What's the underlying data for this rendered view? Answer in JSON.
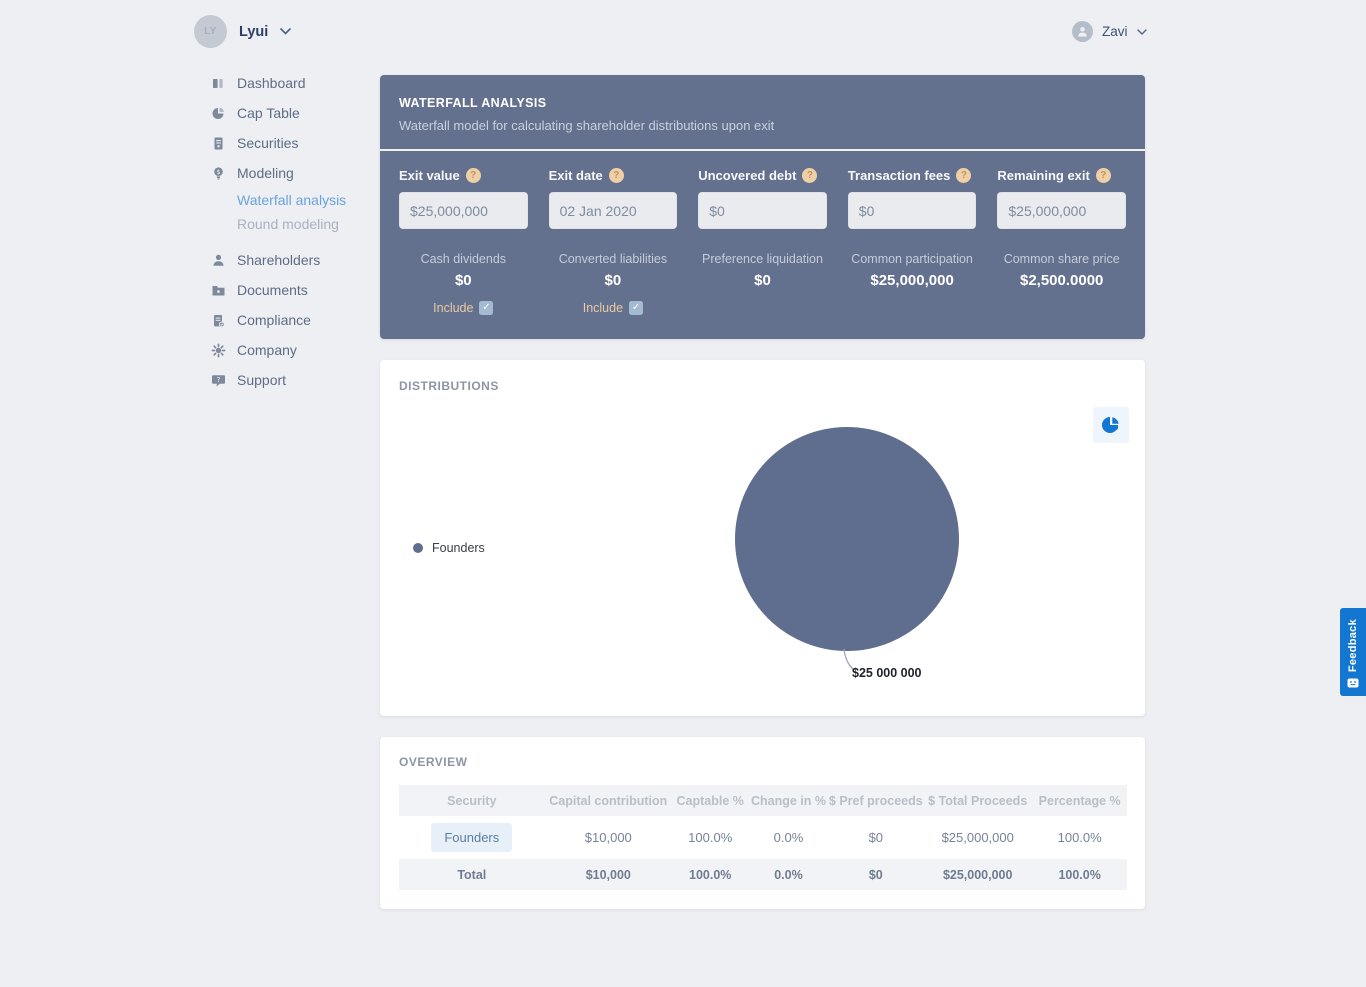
{
  "topbar": {
    "workspace": {
      "initials": "LY",
      "name": "Lyui"
    },
    "user": {
      "name": "Zavi"
    }
  },
  "sidebar": {
    "items": [
      {
        "label": "Dashboard"
      },
      {
        "label": "Cap Table"
      },
      {
        "label": "Securities"
      },
      {
        "label": "Modeling",
        "children": [
          {
            "label": "Waterfall analysis",
            "active": true
          },
          {
            "label": "Round modeling",
            "active": false
          }
        ]
      },
      {
        "label": "Shareholders"
      },
      {
        "label": "Documents"
      },
      {
        "label": "Compliance"
      },
      {
        "label": "Company"
      },
      {
        "label": "Support"
      }
    ]
  },
  "waterfall": {
    "title": "WATERFALL ANALYSIS",
    "subtitle": "Waterfall model for calculating shareholder distributions upon exit",
    "fields": [
      {
        "label": "Exit value",
        "value": "$25,000,000"
      },
      {
        "label": "Exit date",
        "value": "02 Jan 2020"
      },
      {
        "label": "Uncovered debt",
        "value": "$0"
      },
      {
        "label": "Transaction fees",
        "value": "$0"
      },
      {
        "label": "Remaining exit",
        "value": "$25,000,000"
      }
    ],
    "stats": [
      {
        "label": "Cash dividends",
        "value": "$0",
        "include_label": "Include",
        "include_checked": true
      },
      {
        "label": "Converted liabilities",
        "value": "$0",
        "include_label": "Include",
        "include_checked": true
      },
      {
        "label": "Preference liquidation",
        "value": "$0"
      },
      {
        "label": "Common participation",
        "value": "$25,000,000"
      },
      {
        "label": "Common share price",
        "value": "$2,500.0000"
      }
    ]
  },
  "distributions": {
    "title": "DISTRIBUTIONS",
    "legend": [
      {
        "label": "Founders",
        "color": "#5f6e8e"
      }
    ],
    "slice_label": "$25 000 000"
  },
  "chart_data": {
    "type": "pie",
    "title": "DISTRIBUTIONS",
    "labels": [
      "Founders"
    ],
    "values": [
      25000000
    ],
    "value_labels": [
      "$25 000 000"
    ],
    "colors": [
      "#5f6e8e"
    ],
    "legend_position": "left"
  },
  "overview": {
    "title": "OVERVIEW",
    "columns": [
      "Security",
      "Capital contribution",
      "Captable %",
      "Change in %",
      "$ Pref proceeds",
      "$ Total Proceeds",
      "Percentage %"
    ],
    "rows": [
      {
        "security": "Founders",
        "capital_contribution": "$10,000",
        "captable_pct": "100.0%",
        "change_pct": "0.0%",
        "pref_proceeds": "$0",
        "total_proceeds": "$25,000,000",
        "percentage_pct": "100.0%"
      }
    ],
    "total": {
      "security": "Total",
      "capital_contribution": "$10,000",
      "captable_pct": "100.0%",
      "change_pct": "0.0%",
      "pref_proceeds": "$0",
      "total_proceeds": "$25,000,000",
      "percentage_pct": "100.0%"
    }
  },
  "feedback": {
    "label": "Feedback"
  },
  "colors": {
    "panel": "#64718e",
    "pie_slice": "#5f6e8e",
    "accent_blue": "#1377d2",
    "include_text": "#eac9a1",
    "active_nav": "#69a4dc"
  }
}
